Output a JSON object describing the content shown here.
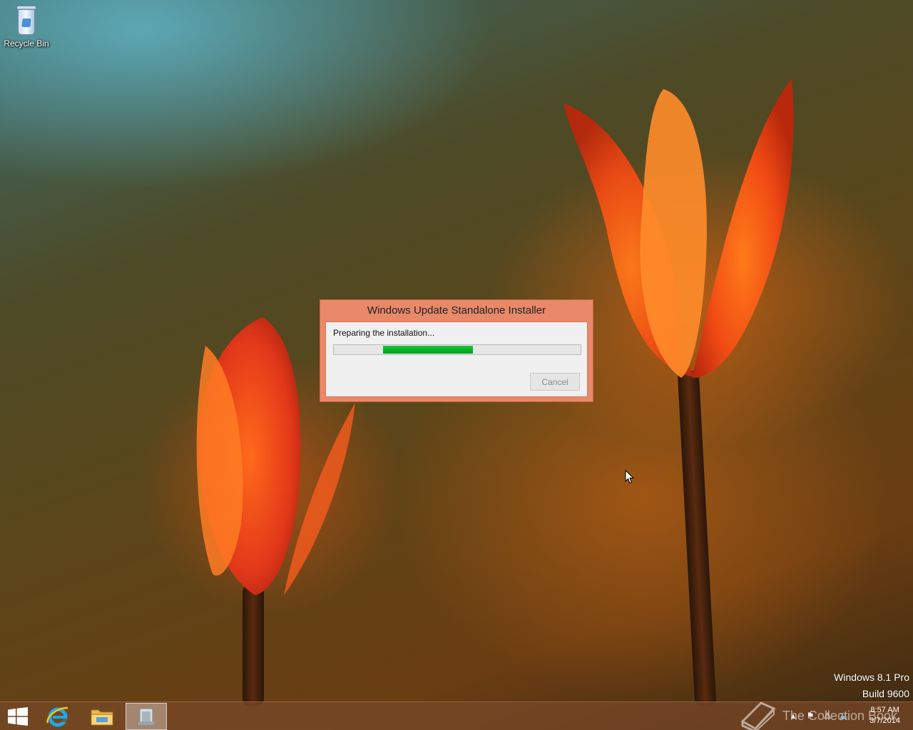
{
  "desktop": {
    "icons": [
      {
        "label": "Recycle Bin",
        "icon": "recycle-bin-icon"
      }
    ]
  },
  "dialog": {
    "title": "Windows Update Standalone Installer",
    "status": "Preparing the installation...",
    "progress": {
      "mode": "marquee",
      "chunk_start": 0.2,
      "chunk_end": 0.565,
      "color": "#06b025"
    },
    "cancel_label": "Cancel",
    "accent": "#e9896a"
  },
  "watermark": {
    "edition": "Windows 8.1 Pro",
    "build": "Build 9600"
  },
  "taskbar": {
    "buttons": [
      {
        "name": "start",
        "icon": "windows-logo-icon"
      },
      {
        "name": "internet-explorer",
        "icon": "internet-explorer-icon"
      },
      {
        "name": "file-explorer",
        "icon": "folder-icon"
      },
      {
        "name": "standalone-installer",
        "icon": "installer-icon",
        "active": true
      }
    ],
    "tray": {
      "icons": [
        "chevron-up-icon",
        "flag-icon",
        "network-warning-icon",
        "speaker-icon"
      ],
      "time": "8:57 AM",
      "date": "3/7/2014"
    }
  },
  "overlay": {
    "text": "The Collection Book",
    "icon": "book-icon"
  }
}
